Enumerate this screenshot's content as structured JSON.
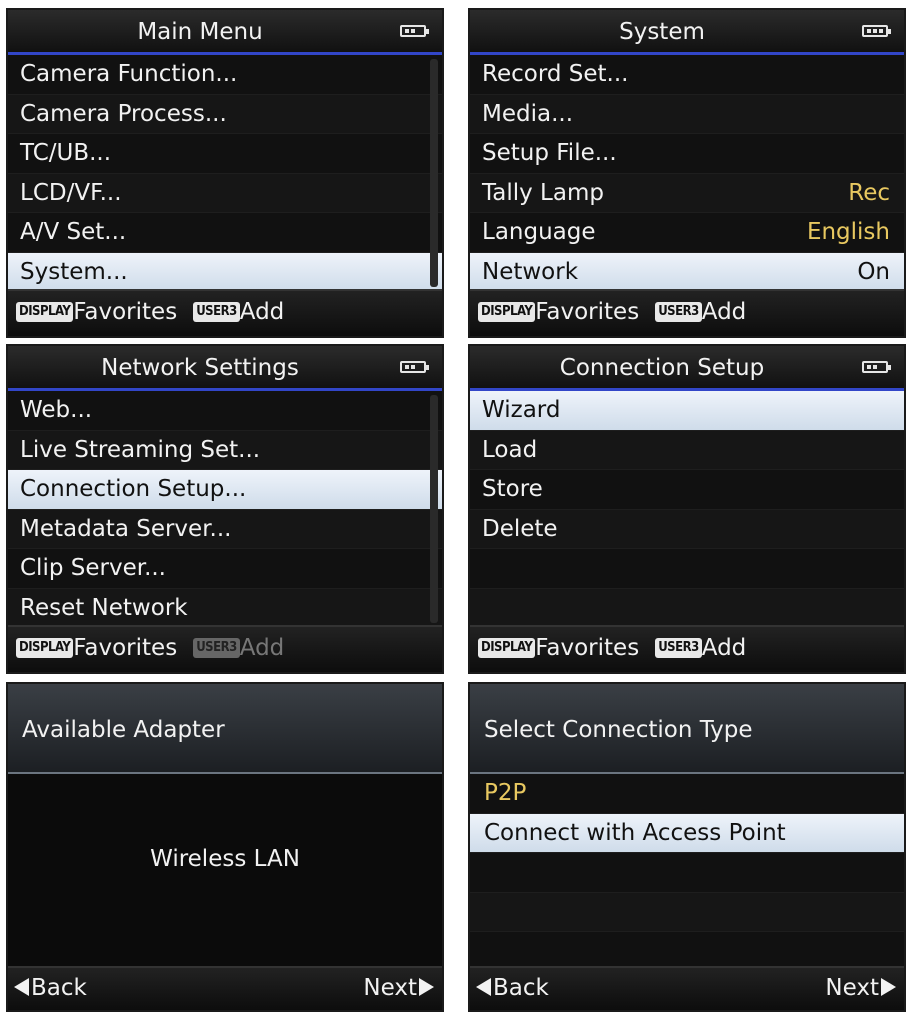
{
  "footer": {
    "display_key": "DISPLAY",
    "favorites": "Favorites",
    "user_key": "USER3",
    "add": "Add"
  },
  "nav": {
    "back": "Back",
    "next": "Next"
  },
  "main_menu": {
    "title": "Main Menu",
    "items": [
      "Camera Function...",
      "Camera Process...",
      "TC/UB...",
      "LCD/VF...",
      "A/V Set...",
      "System..."
    ]
  },
  "system": {
    "title": "System",
    "items": [
      {
        "label": "Record Set...",
        "value": ""
      },
      {
        "label": "Media...",
        "value": ""
      },
      {
        "label": "Setup File...",
        "value": ""
      },
      {
        "label": "Tally Lamp",
        "value": "Rec"
      },
      {
        "label": "Language",
        "value": "English"
      },
      {
        "label": "Network",
        "value": "On"
      }
    ]
  },
  "network_settings": {
    "title": "Network Settings",
    "items": [
      "Web...",
      "Live Streaming Set...",
      "Connection Setup...",
      "Metadata Server...",
      "Clip Server...",
      "Reset Network"
    ]
  },
  "connection_setup": {
    "title": "Connection Setup",
    "items": [
      "Wizard",
      "Load",
      "Store",
      "Delete"
    ]
  },
  "available_adapter": {
    "title": "Available Adapter",
    "adapter": "Wireless LAN"
  },
  "select_connection": {
    "title": "Select Connection Type",
    "items": [
      "P2P",
      "Connect with Access Point"
    ]
  }
}
